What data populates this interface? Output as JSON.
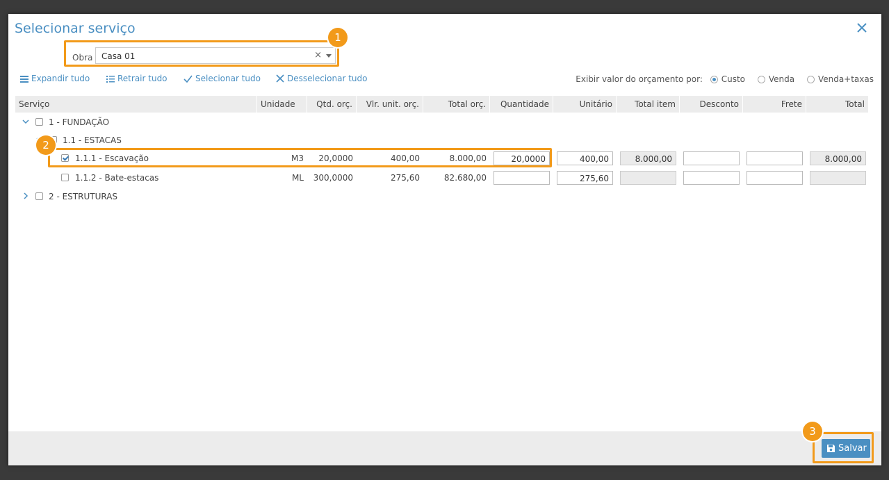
{
  "dialog": {
    "title": "Selecionar serviço",
    "obra_label": "Obra",
    "obra_value": "Casa 01",
    "clear_symbol": "×"
  },
  "badges": [
    "1",
    "2",
    "3"
  ],
  "toolbar": {
    "expand": "Expandir tudo",
    "collapse": "Retrair tudo",
    "select_all": "Selecionar tudo",
    "deselect_all": "Desselecionar tudo"
  },
  "view_options": {
    "label": "Exibir valor do orçamento por:",
    "options": [
      "Custo",
      "Venda",
      "Venda+taxas"
    ],
    "selected": "Custo"
  },
  "table": {
    "columns": [
      "Serviço",
      "Unidade",
      "Qtd. orç.",
      "Vlr. unit. orç.",
      "Total orç.",
      "Quantidade",
      "Unitário",
      "Total item",
      "Desconto",
      "Frete",
      "Total"
    ],
    "rows": [
      {
        "label": "1 - FUNDAÇÃO",
        "level": 0,
        "expanded": true,
        "checked": false
      },
      {
        "label": "1.1 - ESTACAS",
        "level": 1,
        "expanded": true,
        "checked": false
      },
      {
        "label": "1.1.1 - Escavação",
        "level": 2,
        "checked": true,
        "unidade": "M3",
        "qtd_orc": "20,0000",
        "vlr_unit_orc": "400,00",
        "total_orc": "8.000,00",
        "quantidade": "20,0000",
        "unitario": "400,00",
        "total_item": "8.000,00",
        "desconto": "",
        "frete": "",
        "total": "8.000,00"
      },
      {
        "label": "1.1.2 - Bate-estacas",
        "level": 2,
        "checked": false,
        "unidade": "ML",
        "qtd_orc": "300,0000",
        "vlr_unit_orc": "275,60",
        "total_orc": "82.680,00",
        "quantidade": "",
        "unitario": "275,60",
        "total_item": "",
        "desconto": "",
        "frete": "",
        "total": ""
      },
      {
        "label": "2 - ESTRUTURAS",
        "level": 0,
        "expanded": false,
        "checked": false
      }
    ]
  },
  "footer": {
    "save_label": "Salvar"
  },
  "colors": {
    "accent": "#4a8fc2",
    "highlight": "#f29a1a"
  }
}
